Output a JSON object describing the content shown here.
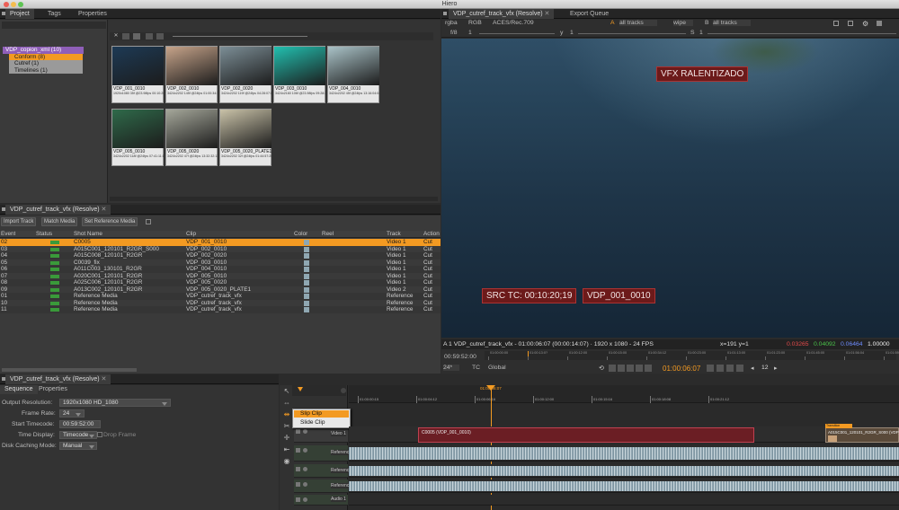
{
  "app": {
    "title": "Hiero"
  },
  "left_tabs": [
    "Project",
    "Tags",
    "Properties"
  ],
  "bins": [
    {
      "label": "VDP_copion_xml (10)",
      "sel": false
    },
    {
      "label": "Conform (8)",
      "sel": true
    },
    {
      "label": "Cutref (1)",
      "sel": false
    },
    {
      "label": "Timelines (1)",
      "sel": false
    }
  ],
  "thumbs": [
    {
      "name": "VDP_001_0010",
      "meta": "1920x1080 35f @23.98fps 00:10:20:01",
      "color": "#1d3a55"
    },
    {
      "name": "VDP_002_0010",
      "meta": "3424x2202 145f @24fps 01:00:34:13",
      "color": "#c7a48a"
    },
    {
      "name": "VDP_002_0020",
      "meta": "3424x2202 119f @24fps 04:28:07:10",
      "color": "#7c8e96"
    },
    {
      "name": "VDP_003_0010",
      "meta": "3424x2160 106f @23.98fps 09:28:32:01",
      "color": "#22c0b0"
    },
    {
      "name": "VDP_004_0010",
      "meta": "3424x2202 45f @24fps 13:16:04:04",
      "color": "#aac3c8"
    },
    {
      "name": "VDP_005_0010",
      "meta": "3424x2202 118f @24fps 07:41:11:17",
      "color": "#2f6a4a"
    },
    {
      "name": "VDP_005_0020",
      "meta": "3424x2202 47f @24fps 13:32:32:13",
      "color": "#a5a79a"
    },
    {
      "name": "VDP_005_0020_PLATE1",
      "meta": "3424x2202 32f @24fps 01:44:57:20",
      "color": "#c9c2a8"
    }
  ],
  "seq_panel": {
    "tab": "VDP_cutref_track_vfx (Resolve)",
    "buttons": [
      "Import Track",
      "Match Media",
      "Set Reference Media"
    ],
    "headers": [
      "Event",
      "Status",
      "Shot Name",
      "Clip",
      "Color",
      "Reel",
      "Track",
      "Action"
    ],
    "rows": [
      {
        "event": "02",
        "shot": "C0005",
        "clip": "VDP_001_0010",
        "track": "Video 1",
        "action": "Cut",
        "sel": true
      },
      {
        "event": "03",
        "shot": "A015C001_120101_R2GR_S000",
        "clip": "VDP_002_0010",
        "track": "Video 1",
        "action": "Cut"
      },
      {
        "event": "04",
        "shot": "A015C008_120101_R2GR",
        "clip": "VDP_002_0020",
        "track": "Video 1",
        "action": "Cut"
      },
      {
        "event": "05",
        "shot": "C0039_fix",
        "clip": "VDP_003_0010",
        "track": "Video 1",
        "action": "Cut"
      },
      {
        "event": "06",
        "shot": "A011C003_130101_R2GR",
        "clip": "VDP_004_0010",
        "track": "Video 1",
        "action": "Cut"
      },
      {
        "event": "07",
        "shot": "A020C001_120101_R2GR",
        "clip": "VDP_005_0010",
        "track": "Video 1",
        "action": "Cut"
      },
      {
        "event": "08",
        "shot": "A025C006_120101_R2GR",
        "clip": "VDP_005_0020",
        "track": "Video 1",
        "action": "Cut"
      },
      {
        "event": "09",
        "shot": "A013C002_120101_R2GR",
        "clip": "VDP_005_0020_PLATE1",
        "track": "Video 2",
        "action": "Cut"
      },
      {
        "event": "01",
        "shot": "Reference Media",
        "clip": "VDP_cutref_track_vfx",
        "track": "Reference",
        "action": "Cut"
      },
      {
        "event": "10",
        "shot": "Reference Media",
        "clip": "VDP_cutref_track_vfx",
        "track": "Reference",
        "action": "Cut"
      },
      {
        "event": "11",
        "shot": "Reference Media",
        "clip": "VDP_cutref_track_vfx",
        "track": "Reference",
        "action": "Cut"
      }
    ]
  },
  "viewer": {
    "tab1": "VDP_cutref_track_vfx (Resolve)",
    "tab2": "Export Queue",
    "toolbar": {
      "ch": "rgba",
      "cs": "RGB",
      "lut": "ACES/Rec.709",
      "a": "A",
      "tracksA": "all tracks",
      "wipe": "wipe",
      "b": "B",
      "tracksB": "all tracks",
      "fstop": "f/8",
      "one": "1",
      "y": "y",
      "yval": "1",
      "s": "S",
      "sval": "1"
    },
    "overlay_top": "VFX RALENTIZADO",
    "overlay_tc": "SRC TC: 00:10:20;19",
    "overlay_clip": "VDP_001_0010",
    "info": "A 1 VDP_cutref_track_vfx - 01:00:06:07 (00:00:14:07) · 1920 x 1080 - 24 FPS",
    "xy": "x=191 y=1",
    "r": "0.03265",
    "g": "0.04092",
    "b": "0.06464",
    "a": "1.00000",
    "tc_left": "00:59:52:00",
    "fps": "24*",
    "tc_mode": "TC",
    "global": "Global",
    "tc_cur": "01:00:06:07",
    "inc": "12",
    "ruler": [
      "01:00:00:00",
      "01:00:13:0?",
      "01:00:12:00",
      "01:00:15:00",
      "01:00:34:12",
      "01:00:23:00",
      "01:01:13:00",
      "01:01:23:00",
      "01:01:45:00",
      "01:01:56:04",
      "01:01:59:00"
    ]
  },
  "props_panel": {
    "tab": "VDP_cutref_track_vfx (Resolve)",
    "subtabs": [
      "Sequence",
      "Properties"
    ],
    "fields": [
      {
        "label": "Output Resolution:",
        "value": "1920x1080 HD_1080"
      },
      {
        "label": "Frame Rate:",
        "value": "24"
      },
      {
        "label": "Start Timecode:",
        "value": "00:59:52:00"
      },
      {
        "label": "Time Display:",
        "value": "Timecode"
      },
      {
        "label": "Disk Caching Mode:",
        "value": "Manual"
      }
    ],
    "drop": "Drop Frame"
  },
  "timeline": {
    "menu": [
      "Slip Clip",
      "Slide Clip"
    ],
    "playhead_tc": "01:00:06:07",
    "ticks": [
      "01:00:00:15",
      "01:00:04:12",
      "01:00:06:16",
      "01:00:12:00",
      "01:00:15:16",
      "01:00:18:08",
      "01:00:21:12"
    ],
    "tracks": [
      "Video 1",
      "Reference",
      "Reference",
      "Reference",
      "Audio 1"
    ],
    "clip1": "C0005 (VDP_001_0010)",
    "clip2": "A015C001_120101_R2GR_S000 (VDP_",
    "transition": "Transition"
  }
}
